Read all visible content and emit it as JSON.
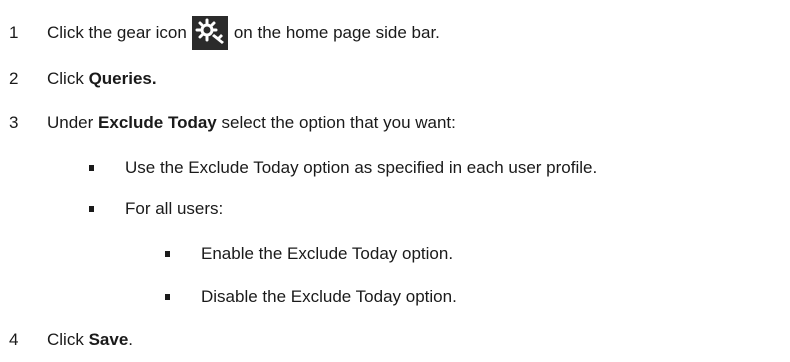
{
  "steps": [
    {
      "num": "1",
      "pre": "Click the gear icon",
      "icon": "gear-icon",
      "post": "on the home page side bar."
    },
    {
      "num": "2",
      "pre": "Click",
      "bold": "Queries."
    },
    {
      "num": "3",
      "pre": "Under",
      "bold": "Exclude Today",
      "post": "select the option that you want:"
    },
    {
      "num": "4",
      "pre": "Click",
      "bold": "Save",
      "post": "."
    }
  ],
  "options": [
    "Use the Exclude Today option as specified in each user profile.",
    "For all users:"
  ],
  "sub_options": [
    "Enable the Exclude Today option.",
    "Disable the Exclude Today option."
  ],
  "colors": {
    "text": "#1a1a1a",
    "icon_background": "#2b2b2b",
    "icon_foreground": "#ffffff"
  }
}
